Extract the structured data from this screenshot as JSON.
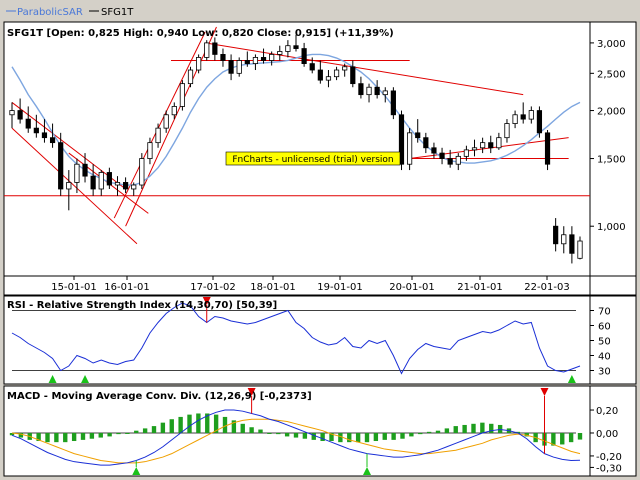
{
  "legend": [
    {
      "label": "ParabolicSAR",
      "color": "#4a78d8"
    },
    {
      "label": "SFG1T",
      "color": "#000000"
    }
  ],
  "price_header": "SFG1T [Open: 0,825  High: 0,940  Low: 0,820  Close: 0,915] (+11,39%)",
  "watermark": "FnCharts - unlicensed (trial) version",
  "colors": {
    "up_candle": "#ffffff",
    "down_candle": "#000000",
    "trendline": "#e00000",
    "sar_ma": "#7ea6e0",
    "rsi_line": "#1a2fd6",
    "macd_line": "#1a2fd6",
    "signal_line": "#f0a000",
    "histogram": "#1e9e1e",
    "buy_arrow": "#19c219",
    "sell_arrow": "#e00000"
  },
  "rsi_title": "RSI - Relative Strength Index (14,30,70) [50,39]",
  "macd_title": "MACD - Moving Average Conv. Div. (12,26,9) [-0,2373]",
  "chart_data": [
    {
      "type": "candlestick",
      "scale": "log",
      "x_ticks": [
        "15-01-01",
        "16-01-01",
        "17-01-02",
        "18-01-01",
        "19-01-01",
        "20-01-01",
        "21-01-01",
        "22-01-03"
      ],
      "y_ticks": [
        "3,000",
        "2,500",
        "2,000",
        "1,500",
        "1,000"
      ],
      "y_tick_values": [
        3.0,
        2.5,
        2.0,
        1.5,
        1.0
      ],
      "ylim": [
        0.76,
        3.3
      ],
      "candles": [
        [
          1.95,
          2.1,
          1.8,
          2.0
        ],
        [
          2.0,
          2.15,
          1.85,
          1.9
        ],
        [
          1.9,
          2.05,
          1.75,
          1.8
        ],
        [
          1.8,
          1.95,
          1.7,
          1.75
        ],
        [
          1.75,
          1.9,
          1.65,
          1.7
        ],
        [
          1.7,
          1.85,
          1.6,
          1.65
        ],
        [
          1.65,
          1.75,
          1.2,
          1.25
        ],
        [
          1.25,
          1.4,
          1.1,
          1.3
        ],
        [
          1.3,
          1.5,
          1.22,
          1.45
        ],
        [
          1.45,
          1.55,
          1.3,
          1.35
        ],
        [
          1.35,
          1.45,
          1.2,
          1.25
        ],
        [
          1.25,
          1.4,
          1.2,
          1.38
        ],
        [
          1.38,
          1.42,
          1.25,
          1.28
        ],
        [
          1.28,
          1.35,
          1.2,
          1.3
        ],
        [
          1.3,
          1.34,
          1.22,
          1.25
        ],
        [
          1.25,
          1.3,
          1.2,
          1.28
        ],
        [
          1.28,
          1.55,
          1.25,
          1.5
        ],
        [
          1.5,
          1.7,
          1.45,
          1.65
        ],
        [
          1.65,
          1.85,
          1.6,
          1.8
        ],
        [
          1.8,
          2.0,
          1.75,
          1.95
        ],
        [
          1.95,
          2.1,
          1.9,
          2.05
        ],
        [
          2.05,
          2.4,
          2.0,
          2.35
        ],
        [
          2.35,
          2.6,
          2.3,
          2.55
        ],
        [
          2.55,
          2.8,
          2.5,
          2.75
        ],
        [
          2.75,
          3.05,
          2.7,
          3.0
        ],
        [
          3.0,
          3.1,
          2.7,
          2.8
        ],
        [
          2.8,
          2.9,
          2.6,
          2.7
        ],
        [
          2.7,
          2.8,
          2.4,
          2.5
        ],
        [
          2.5,
          2.75,
          2.45,
          2.7
        ],
        [
          2.7,
          2.85,
          2.6,
          2.65
        ],
        [
          2.65,
          2.8,
          2.55,
          2.75
        ],
        [
          2.75,
          2.9,
          2.65,
          2.7
        ],
        [
          2.7,
          2.85,
          2.62,
          2.8
        ],
        [
          2.8,
          2.95,
          2.7,
          2.85
        ],
        [
          2.85,
          3.05,
          2.75,
          2.95
        ],
        [
          2.95,
          3.15,
          2.85,
          2.9
        ],
        [
          2.9,
          3.0,
          2.6,
          2.65
        ],
        [
          2.65,
          2.75,
          2.5,
          2.55
        ],
        [
          2.55,
          2.7,
          2.35,
          2.4
        ],
        [
          2.4,
          2.55,
          2.3,
          2.45
        ],
        [
          2.45,
          2.6,
          2.4,
          2.55
        ],
        [
          2.55,
          2.65,
          2.45,
          2.6
        ],
        [
          2.6,
          2.7,
          2.3,
          2.35
        ],
        [
          2.35,
          2.45,
          2.15,
          2.2
        ],
        [
          2.2,
          2.35,
          2.1,
          2.3
        ],
        [
          2.3,
          2.4,
          2.15,
          2.2
        ],
        [
          2.2,
          2.3,
          2.1,
          2.25
        ],
        [
          2.25,
          2.3,
          1.9,
          1.95
        ],
        [
          1.95,
          2.0,
          1.4,
          1.45
        ],
        [
          1.45,
          1.8,
          1.4,
          1.75
        ],
        [
          1.75,
          1.9,
          1.65,
          1.7
        ],
        [
          1.7,
          1.75,
          1.55,
          1.6
        ],
        [
          1.6,
          1.65,
          1.5,
          1.55
        ],
        [
          1.55,
          1.6,
          1.45,
          1.5
        ],
        [
          1.5,
          1.58,
          1.42,
          1.45
        ],
        [
          1.45,
          1.55,
          1.4,
          1.52
        ],
        [
          1.52,
          1.62,
          1.48,
          1.58
        ],
        [
          1.58,
          1.68,
          1.52,
          1.6
        ],
        [
          1.6,
          1.7,
          1.55,
          1.65
        ],
        [
          1.65,
          1.72,
          1.55,
          1.6
        ],
        [
          1.6,
          1.75,
          1.58,
          1.7
        ],
        [
          1.7,
          1.9,
          1.65,
          1.85
        ],
        [
          1.85,
          2.0,
          1.8,
          1.95
        ],
        [
          1.95,
          2.1,
          1.85,
          1.9
        ],
        [
          1.9,
          2.05,
          1.85,
          2.0
        ],
        [
          2.0,
          2.05,
          1.7,
          1.75
        ],
        [
          1.75,
          1.78,
          1.4,
          1.45
        ],
        [
          1.0,
          1.05,
          0.86,
          0.9
        ],
        [
          0.9,
          1.0,
          0.85,
          0.95
        ],
        [
          0.95,
          1.0,
          0.8,
          0.85
        ],
        [
          0.825,
          0.94,
          0.82,
          0.915
        ]
      ],
      "sar_ma": [
        2.6,
        2.4,
        2.2,
        2.05,
        1.9,
        1.75,
        1.62,
        1.52,
        1.45,
        1.4,
        1.36,
        1.33,
        1.3,
        1.29,
        1.28,
        1.28,
        1.3,
        1.35,
        1.42,
        1.52,
        1.65,
        1.8,
        1.98,
        2.15,
        2.3,
        2.42,
        2.52,
        2.58,
        2.62,
        2.64,
        2.65,
        2.66,
        2.67,
        2.68,
        2.7,
        2.74,
        2.78,
        2.8,
        2.8,
        2.78,
        2.74,
        2.68,
        2.6,
        2.52,
        2.42,
        2.3,
        2.18,
        2.05,
        1.92,
        1.8,
        1.7,
        1.62,
        1.56,
        1.51,
        1.48,
        1.47,
        1.46,
        1.46,
        1.47,
        1.48,
        1.5,
        1.53,
        1.57,
        1.62,
        1.68,
        1.75,
        1.82,
        1.9,
        1.98,
        2.05,
        2.1
      ],
      "sar_ma_start": 40,
      "trendlines": [
        [
          [
            0,
            2.1
          ],
          [
            20,
            1.25
          ]
        ],
        [
          [
            0,
            1.8
          ],
          [
            22,
            0.9
          ]
        ],
        [
          [
            10,
            1.55
          ],
          [
            24,
            1.08
          ]
        ],
        [
          [
            18,
            1.05
          ],
          [
            34,
            3.2
          ]
        ],
        [
          [
            20,
            1.0
          ],
          [
            36,
            3.3
          ]
        ],
        [
          [
            28,
            2.7
          ],
          [
            70,
            2.7
          ]
        ],
        [
          [
            34,
            3.0
          ],
          [
            90,
            2.2
          ]
        ],
        [
          [
            70,
            1.5
          ],
          [
            98,
            1.7
          ]
        ],
        [
          [
            70,
            1.5
          ],
          [
            98,
            1.5
          ]
        ]
      ],
      "support_level": 1.2,
      "resistance_level": 2.7
    },
    {
      "type": "line",
      "name": "RSI",
      "y_ticks": [
        70,
        60,
        50,
        40,
        30
      ],
      "ylim": [
        23,
        77
      ],
      "levels": [
        70,
        30
      ],
      "values": [
        55,
        52,
        48,
        45,
        42,
        38,
        30,
        33,
        40,
        38,
        35,
        37,
        35,
        34,
        36,
        37,
        45,
        55,
        62,
        68,
        72,
        75,
        73,
        66,
        62,
        66,
        65,
        63,
        62,
        61,
        62,
        64,
        66,
        68,
        70,
        62,
        58,
        52,
        49,
        47,
        48,
        52,
        46,
        45,
        50,
        48,
        50,
        40,
        28,
        38,
        44,
        48,
        46,
        45,
        44,
        50,
        52,
        54,
        56,
        55,
        57,
        60,
        63,
        61,
        62,
        45,
        33,
        30,
        29,
        31,
        33
      ],
      "buy_markers": [
        5,
        9,
        69
      ],
      "sell_markers": [
        24
      ]
    },
    {
      "type": "line_histogram",
      "name": "MACD",
      "y_ticks": [
        "0,20",
        "0,00",
        "-0,20",
        "-0,30"
      ],
      "y_tick_values": [
        0.2,
        0.0,
        -0.2,
        -0.3
      ],
      "ylim": [
        -0.34,
        0.27
      ],
      "macd": [
        -0.02,
        -0.05,
        -0.09,
        -0.13,
        -0.17,
        -0.2,
        -0.23,
        -0.25,
        -0.26,
        -0.27,
        -0.28,
        -0.28,
        -0.27,
        -0.26,
        -0.24,
        -0.21,
        -0.17,
        -0.12,
        -0.06,
        0.0,
        0.06,
        0.11,
        0.15,
        0.18,
        0.2,
        0.2,
        0.19,
        0.17,
        0.15,
        0.12,
        0.1,
        0.07,
        0.04,
        0.01,
        -0.02,
        -0.05,
        -0.08,
        -0.11,
        -0.14,
        -0.16,
        -0.18,
        -0.19,
        -0.2,
        -0.21,
        -0.21,
        -0.2,
        -0.19,
        -0.17,
        -0.15,
        -0.12,
        -0.09,
        -0.06,
        -0.03,
        0.0,
        0.02,
        0.03,
        0.02,
        0.0,
        -0.05,
        -0.12,
        -0.18,
        -0.21,
        -0.23,
        -0.24,
        -0.2373
      ],
      "signal": [
        0.0,
        -0.01,
        -0.03,
        -0.06,
        -0.09,
        -0.12,
        -0.15,
        -0.18,
        -0.2,
        -0.22,
        -0.24,
        -0.25,
        -0.26,
        -0.26,
        -0.26,
        -0.25,
        -0.23,
        -0.21,
        -0.18,
        -0.14,
        -0.1,
        -0.06,
        -0.02,
        0.02,
        0.06,
        0.09,
        0.11,
        0.12,
        0.12,
        0.12,
        0.11,
        0.1,
        0.08,
        0.06,
        0.04,
        0.02,
        -0.01,
        -0.03,
        -0.06,
        -0.08,
        -0.1,
        -0.12,
        -0.14,
        -0.15,
        -0.16,
        -0.17,
        -0.18,
        -0.18,
        -0.17,
        -0.16,
        -0.15,
        -0.13,
        -0.11,
        -0.09,
        -0.06,
        -0.04,
        -0.02,
        -0.01,
        -0.02,
        -0.04,
        -0.07,
        -0.1,
        -0.13,
        -0.16,
        -0.18
      ],
      "buy_markers": [
        14,
        40
      ],
      "sell_markers": [
        27,
        60
      ]
    }
  ]
}
